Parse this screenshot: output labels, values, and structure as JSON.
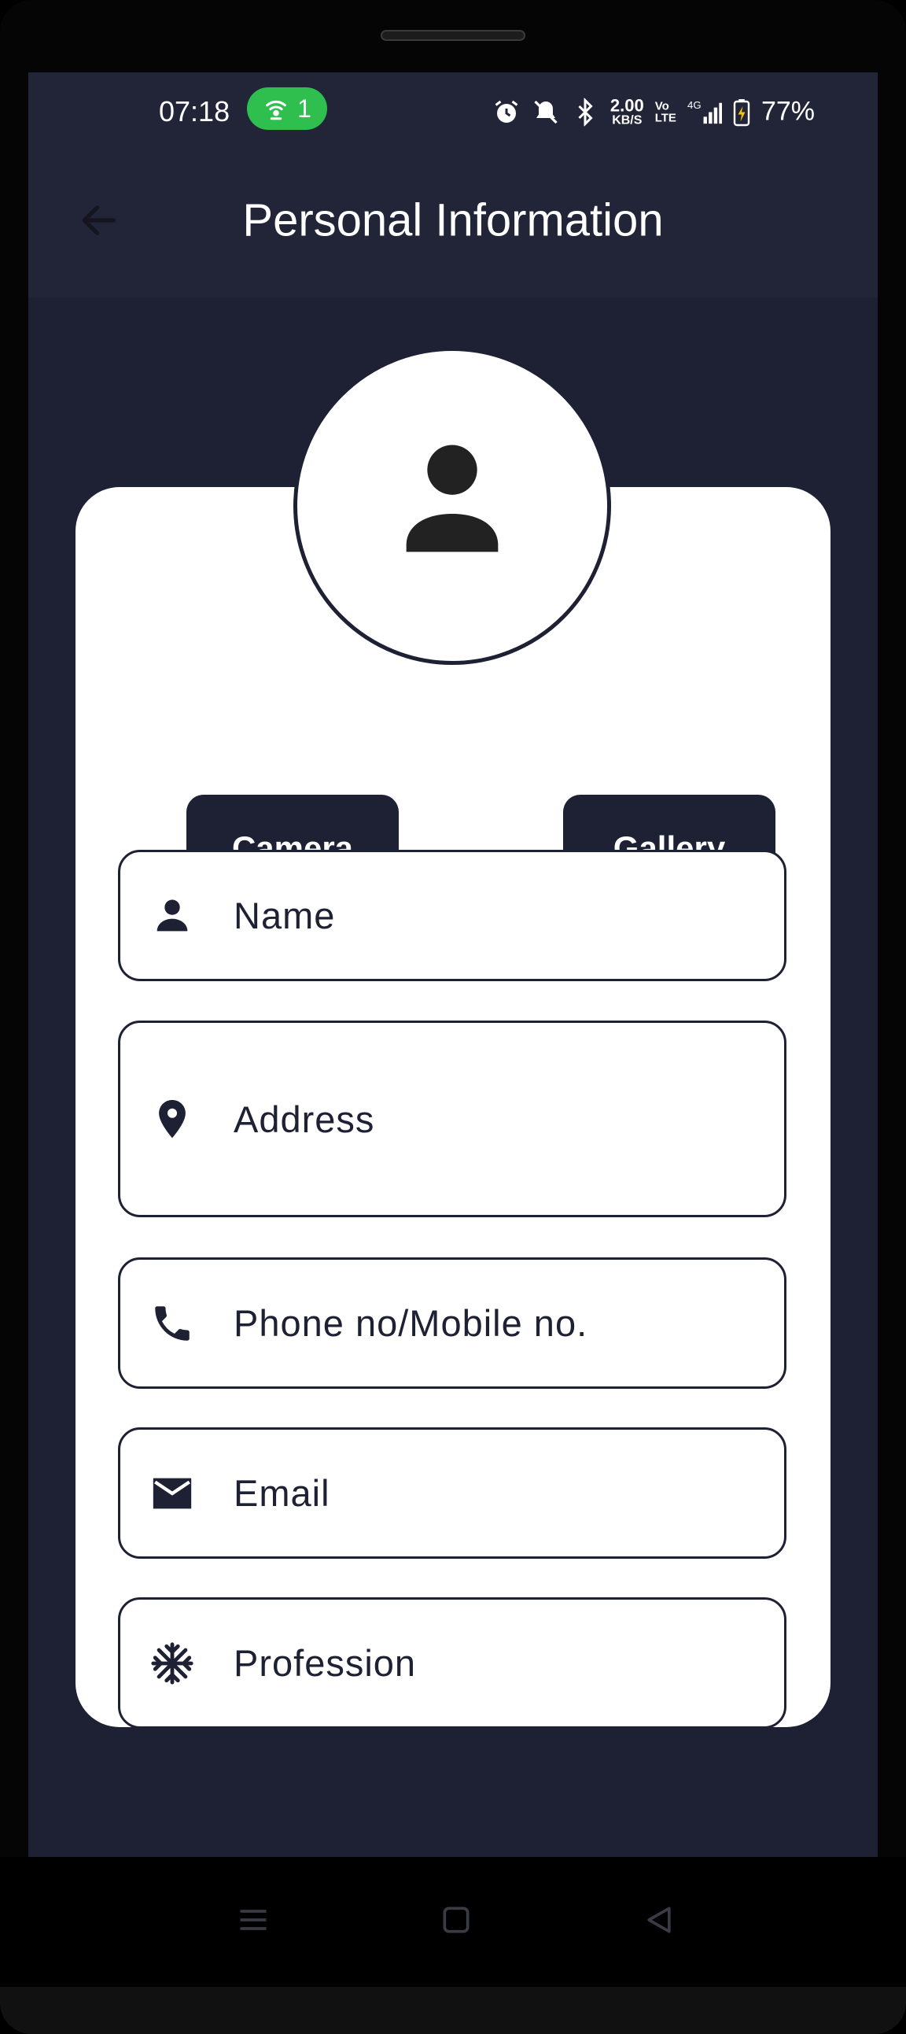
{
  "status_bar": {
    "time": "07:18",
    "hotspot_count": "1",
    "net_speed_value": "2.00",
    "net_speed_unit": "KB/S",
    "volte_top": "Vo",
    "volte_bottom": "LTE",
    "network": "4G",
    "battery": "77%",
    "icons": [
      "alarm-icon",
      "mute-icon",
      "bluetooth-icon",
      "signal-icon",
      "battery-charging-icon"
    ]
  },
  "app_bar": {
    "title": "Personal Information",
    "back_icon": "arrow-left-icon"
  },
  "profile": {
    "avatar_icon": "person-icon",
    "camera_label": "Camera",
    "gallery_label": "Gallery"
  },
  "form": {
    "fields": [
      {
        "placeholder": "Name",
        "icon": "person-icon"
      },
      {
        "placeholder": "Address",
        "icon": "location-pin-icon"
      },
      {
        "placeholder": "Phone no/Mobile no.",
        "icon": "phone-icon"
      },
      {
        "placeholder": "Email",
        "icon": "mail-icon"
      },
      {
        "placeholder": "Profession",
        "icon": "snowflake-icon"
      }
    ]
  },
  "nav_bar": {
    "items": [
      "menu-icon",
      "home-icon",
      "back-icon"
    ]
  },
  "colors": {
    "primary": "#1e2033",
    "app_bar": "#222538",
    "hotspot_badge": "#2fbf4f",
    "card": "#ffffff"
  }
}
